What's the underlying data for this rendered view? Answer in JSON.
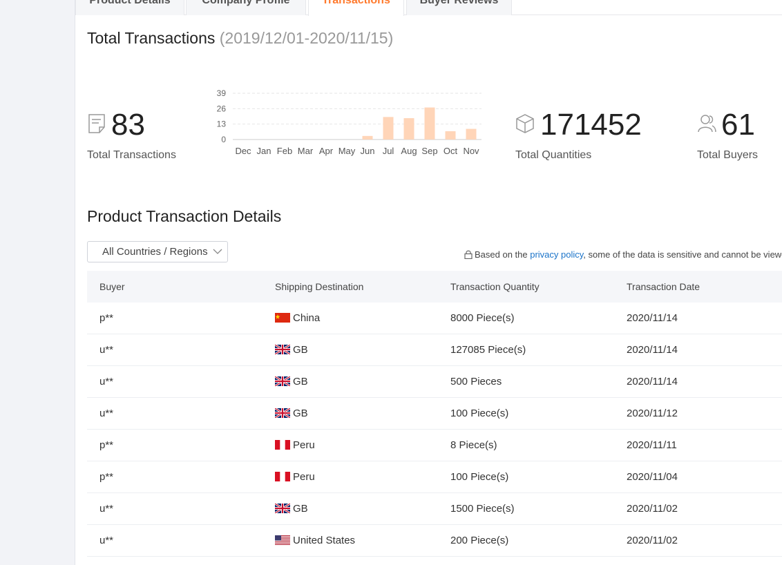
{
  "tabs": [
    "Product Details",
    "Company Profile",
    "Transactions",
    "Buyer Reviews"
  ],
  "active_tab": "Transactions",
  "summary": {
    "title": "Total Transactions",
    "date_range": "(2019/12/01-2020/11/15)",
    "total_transactions": "83",
    "total_transactions_label": "Total Transactions",
    "total_quantities": "171452",
    "total_quantities_label": "Total Quantities",
    "total_buyers": "61",
    "total_buyers_label": "Total Buyers"
  },
  "chart_data": {
    "type": "bar",
    "categories": [
      "Dec",
      "Jan",
      "Feb",
      "Mar",
      "Apr",
      "May",
      "Jun",
      "Jul",
      "Aug",
      "Sep",
      "Oct",
      "Nov"
    ],
    "values": [
      0,
      0,
      0,
      0,
      0,
      0,
      3,
      19,
      18,
      27,
      7,
      9
    ],
    "yticks": [
      0,
      13,
      26,
      39
    ],
    "ylim": [
      0,
      39
    ],
    "grid": true,
    "bar_color": "#ffd5b8"
  },
  "details": {
    "title": "Product Transaction Details",
    "filter_label": "All Countries / Regions",
    "notice_prefix": "Based on the ",
    "notice_link": "privacy policy",
    "notice_suffix": ", some of the data is sensitive and cannot be viewed."
  },
  "table": {
    "columns": [
      "Buyer",
      "Shipping Destination",
      "Transaction Quantity",
      "Transaction Date"
    ],
    "rows": [
      {
        "buyer": "p**",
        "flag": "cn",
        "destination": "China",
        "quantity": "8000 Piece(s)",
        "date": "2020/11/14"
      },
      {
        "buyer": "u**",
        "flag": "gb",
        "destination": "GB",
        "quantity": "127085 Piece(s)",
        "date": "2020/11/14"
      },
      {
        "buyer": "u**",
        "flag": "gb",
        "destination": "GB",
        "quantity": "500 Pieces",
        "date": "2020/11/14"
      },
      {
        "buyer": "u**",
        "flag": "gb",
        "destination": "GB",
        "quantity": "100 Piece(s)",
        "date": "2020/11/12"
      },
      {
        "buyer": "p**",
        "flag": "pe",
        "destination": "Peru",
        "quantity": "8 Piece(s)",
        "date": "2020/11/11"
      },
      {
        "buyer": "p**",
        "flag": "pe",
        "destination": "Peru",
        "quantity": "100 Piece(s)",
        "date": "2020/11/04"
      },
      {
        "buyer": "u**",
        "flag": "gb",
        "destination": "GB",
        "quantity": "1500 Piece(s)",
        "date": "2020/11/02"
      },
      {
        "buyer": "u**",
        "flag": "us",
        "destination": "United States",
        "quantity": "200 Piece(s)",
        "date": "2020/11/02"
      }
    ]
  },
  "colors": {
    "accent": "#ff7a2d",
    "link": "#1a73c9"
  }
}
